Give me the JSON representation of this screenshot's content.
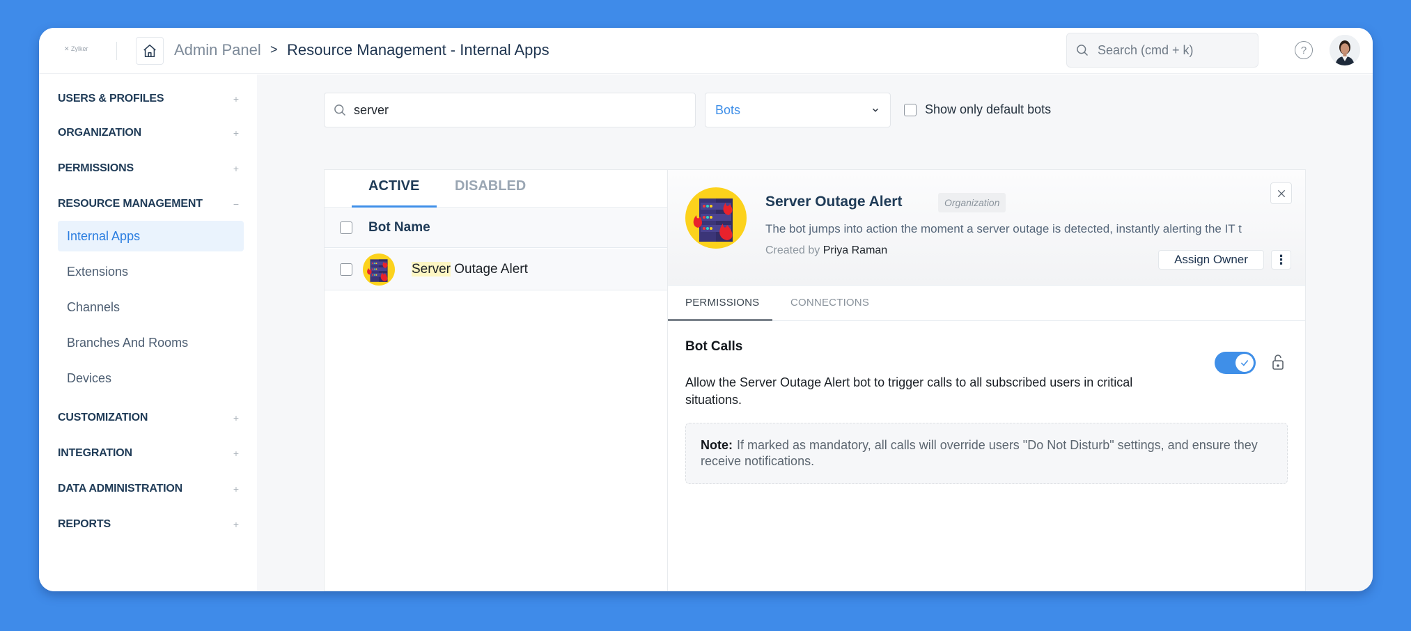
{
  "header": {
    "logo_text": "Zylker",
    "breadcrumb_root": "Admin Panel",
    "breadcrumb_separator": ">",
    "breadcrumb_current": "Resource Management - Internal Apps",
    "search_placeholder": "Search (cmd + k)",
    "help_symbol": "?"
  },
  "sidebar": {
    "sections": [
      {
        "label": "USERS & PROFILES",
        "toggle": "+"
      },
      {
        "label": "ORGANIZATION",
        "toggle": "+"
      },
      {
        "label": "PERMISSIONS",
        "toggle": "+"
      },
      {
        "label": "RESOURCE MANAGEMENT",
        "toggle": "−"
      },
      {
        "label": "CUSTOMIZATION",
        "toggle": "+"
      },
      {
        "label": "INTEGRATION",
        "toggle": "+"
      },
      {
        "label": "DATA ADMINISTRATION",
        "toggle": "+"
      },
      {
        "label": "REPORTS",
        "toggle": "+"
      }
    ],
    "resource_items": [
      {
        "label": "Internal Apps",
        "active": true
      },
      {
        "label": "Extensions"
      },
      {
        "label": "Channels"
      },
      {
        "label": "Branches And Rooms"
      },
      {
        "label": "Devices"
      }
    ]
  },
  "filters": {
    "search_value": "server",
    "type_selected": "Bots",
    "default_only_label": "Show only default bots",
    "default_only_checked": false
  },
  "list": {
    "tabs": [
      {
        "label": "ACTIVE",
        "active": true
      },
      {
        "label": "DISABLED"
      }
    ],
    "column_header": "Bot Name",
    "rows": [
      {
        "highlight": "Server",
        "rest": " Outage Alert"
      }
    ]
  },
  "detail": {
    "title": "Server Outage Alert",
    "scope_badge": "Organization",
    "description": "The bot jumps into action the moment a server outage is detected, instantly alerting the IT t",
    "created_by_label": "Created by",
    "created_by_name": "Priya Raman",
    "assign_owner_label": "Assign Owner",
    "more_symbol": "⋮",
    "subtabs": [
      {
        "label": "PERMISSIONS",
        "active": true
      },
      {
        "label": "CONNECTIONS"
      }
    ],
    "permission": {
      "title": "Bot Calls",
      "description": "Allow the Server Outage Alert bot to trigger calls to all subscribed users in critical situations.",
      "enabled": true,
      "note_label": "Note:",
      "note_text": "If marked as mandatory, all calls will override users \"Do Not Disturb\" settings, and ensure they receive notifications."
    }
  },
  "colors": {
    "background": "#3f8be9",
    "accent": "#3f8fe8",
    "active_nav_bg": "#eaf3fd",
    "highlight": "#fdf6c3"
  }
}
